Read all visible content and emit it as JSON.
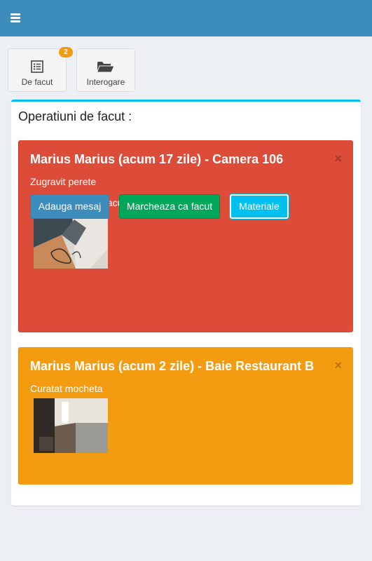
{
  "header": {
    "menu_icon": "hamburger-icon",
    "color": "#3c8dbc"
  },
  "tiles": [
    {
      "label": "De facut",
      "icon": "list-icon",
      "badge": "2"
    },
    {
      "label": "Interogare",
      "icon": "folder-open-icon"
    }
  ],
  "main": {
    "title": "Operatiuni de facut :",
    "cards": [
      {
        "title": "Marius Marius (acum 17 zile) - Camera 106",
        "description": "Zugravit perete",
        "message": "Marius Marius acum 2 zile : Test",
        "close": "×",
        "color": "#dd4b39",
        "buttons": {
          "add_message": "Adauga mesaj",
          "mark_done": "Marcheaza ca facut",
          "materials": "Materiale"
        }
      },
      {
        "title": "Marius Marius (acum 2 zile) - Baie Restaurant B",
        "description": "Curatat mocheta",
        "close": "×",
        "color": "#f39c12"
      }
    ]
  }
}
